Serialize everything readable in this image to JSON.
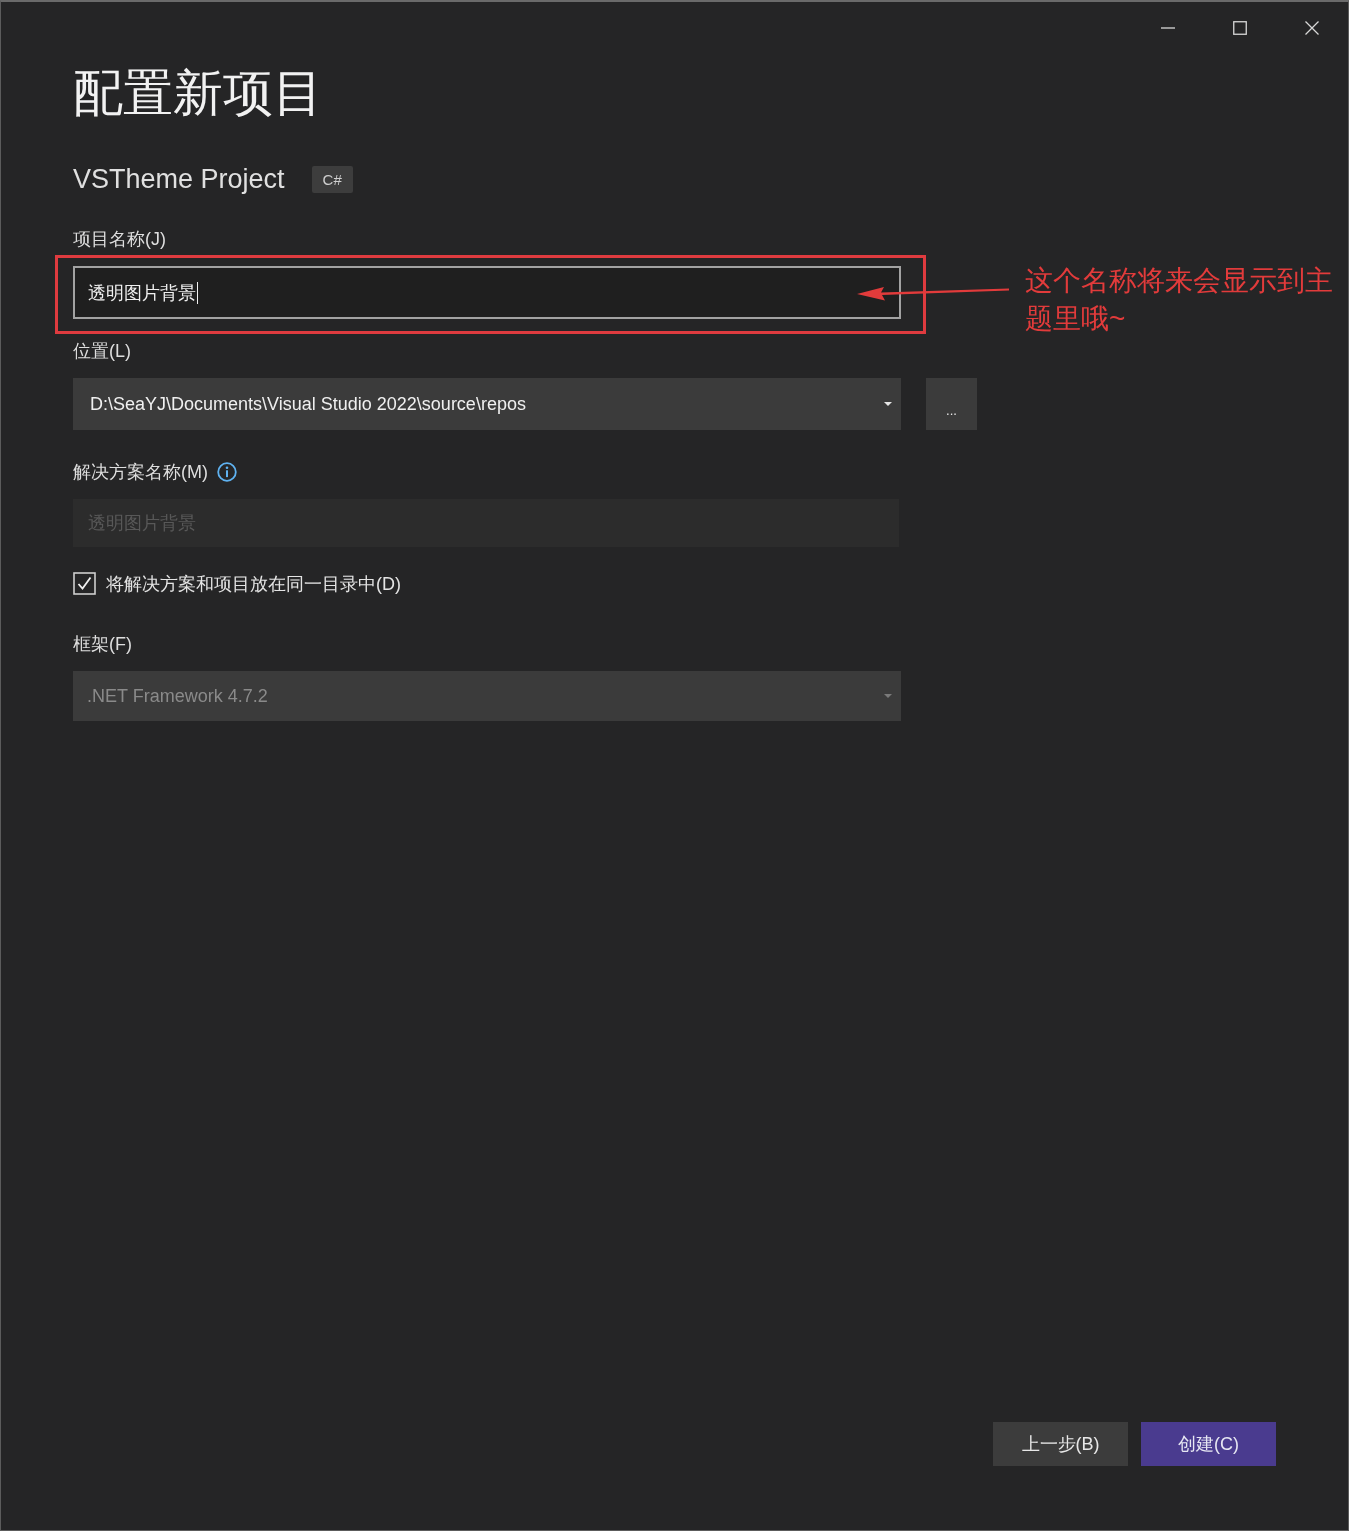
{
  "title": "配置新项目",
  "project": {
    "name": "VSTheme Project",
    "language": "C#"
  },
  "fields": [
    {
      "kind": "text",
      "label": "项目名称(J)",
      "value": "透明图片背景",
      "focused": true,
      "disabled": false,
      "annotation": {
        "text": "这个名称将来会显示到主题里哦~"
      }
    },
    {
      "kind": "combo",
      "label": "位置(L)",
      "value": "D:\\SeaYJ\\Documents\\Visual Studio 2022\\source\\repos",
      "disabled": false,
      "browse_button": "..."
    },
    {
      "kind": "text",
      "label": "解决方案名称(M)",
      "info": true,
      "value": "透明图片背景",
      "focused": false,
      "disabled": true
    },
    {
      "kind": "checkbox",
      "label": "将解决方案和项目放在同一目录中(D)",
      "checked": true
    },
    {
      "kind": "combo",
      "label": "框架(F)",
      "value": ".NET Framework 4.7.2",
      "disabled": true
    }
  ],
  "buttons": [
    {
      "label": "上一步(B)",
      "primary": false
    },
    {
      "label": "创建(C)",
      "primary": true
    }
  ]
}
